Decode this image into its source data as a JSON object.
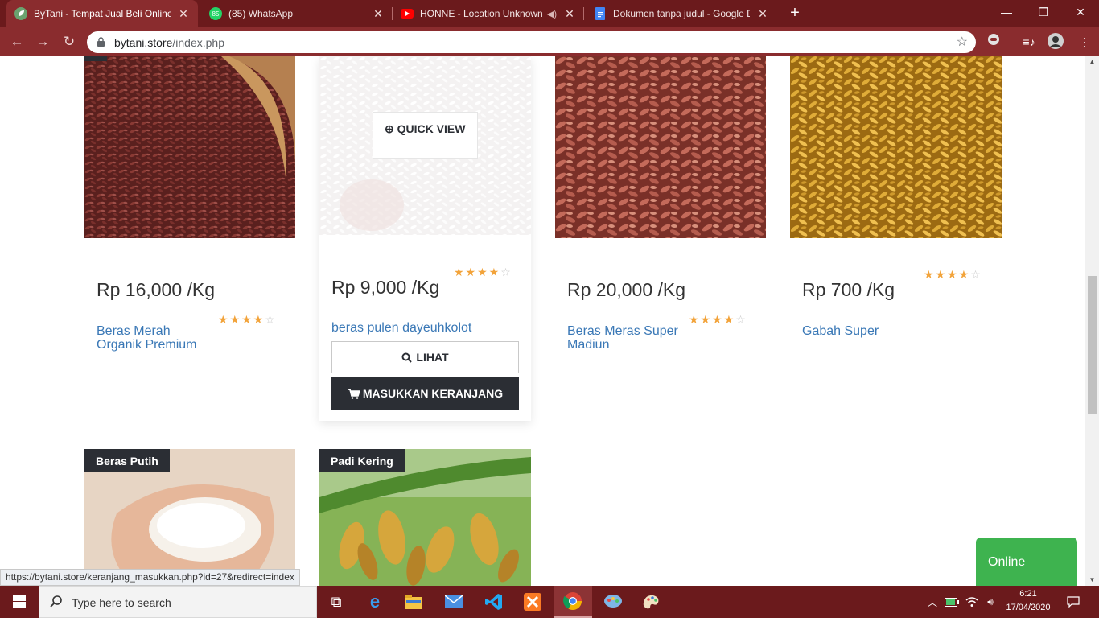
{
  "browser": {
    "tabs": [
      {
        "title": "ByTani - Tempat Jual Beli Online P",
        "active": true,
        "favicon": "leaf-icon"
      },
      {
        "title": "(85) WhatsApp",
        "active": false,
        "favicon": "whatsapp-icon",
        "badge": "85"
      },
      {
        "title": "HONNE - Location Unknown",
        "active": false,
        "favicon": "youtube-icon"
      },
      {
        "title": "Dokumen tanpa judul - Google D",
        "active": false,
        "favicon": "google-docs-icon"
      }
    ],
    "url_domain": "bytani.store",
    "url_path": "/index.php",
    "status_url": "https://bytani.store/keranjang_masukkan.php?id=27&redirect=index"
  },
  "products": [
    {
      "price": "Rp 16,000 /Kg",
      "name": "Beras Merah Organik Premium",
      "rating": 4
    },
    {
      "price": "Rp 9,000 /Kg",
      "name": "beras pulen dayeuhkolot",
      "rating": 4
    },
    {
      "price": "Rp 20,000 /Kg",
      "name": "Beras Meras Super Madiun",
      "rating": 4
    },
    {
      "price": "Rp 700 /Kg",
      "name": "Gabah Super",
      "rating": 4
    }
  ],
  "second_row": [
    {
      "category": "Beras Putih"
    },
    {
      "category": "Padi Kering"
    }
  ],
  "actions": {
    "quick_view": "QUICK VIEW",
    "lihat": "LIHAT",
    "add_to_cart": "MASUKKAN KERANJANG"
  },
  "chat_widget": {
    "label": "Online"
  },
  "taskbar": {
    "search_placeholder": "Type here to search",
    "time": "6:21",
    "date": "17/04/2020"
  },
  "colors": {
    "chrome_dark": "#6b1a1c",
    "chrome_toolbar": "#8a2c2e",
    "label_dark": "#2b2e34",
    "link_blue": "#3a78b6",
    "star_gold": "#f2a33a",
    "online_green": "#3eb34f"
  }
}
